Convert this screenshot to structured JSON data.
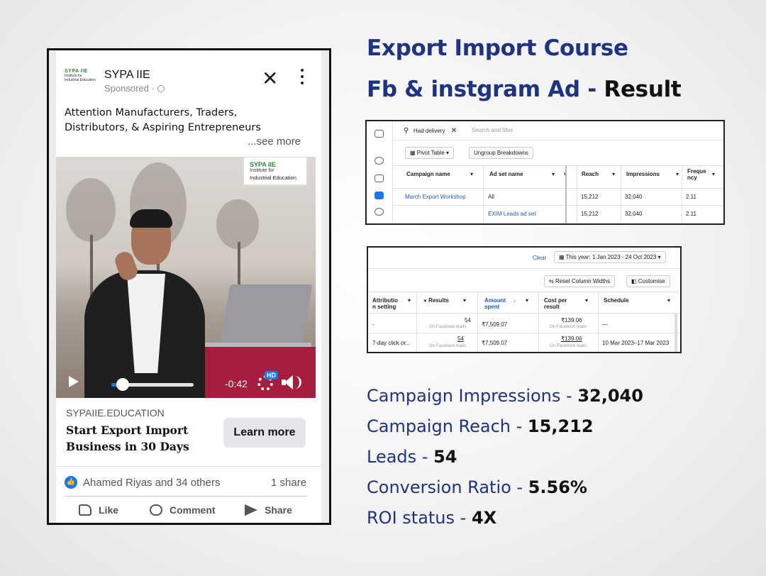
{
  "ad": {
    "logo_line1": "SYPA IIE",
    "logo_line2": "Institute for Industrial Education",
    "page_name": "SYPA IIE",
    "sponsored": "Sponsored ·",
    "body_text": "Attention Manufacturers, Traders, Distributors, & Aspiring Entrepreneurs",
    "see_more": "...see more",
    "video": {
      "watermark_line1": "SYPA IIE",
      "watermark_line2": "Institute for",
      "watermark_line3": "Industrial Education",
      "time_remaining": "-0:42",
      "hd_badge": "HD",
      "progress": 0.14
    },
    "domain": "SYPAIIE.EDUCATION",
    "headline": "Start Export Import Business in 30 Days",
    "cta": "Learn more",
    "reactions": "Ahamed Riyas and 34 others",
    "shares": "1 share",
    "actions": {
      "like": "Like",
      "comment": "Comment",
      "share": "Share"
    }
  },
  "title": {
    "line1": "Export Import Course",
    "line2_prefix": "Fb & instgram Ad -",
    "line2_result": "Result"
  },
  "ads_manager_1": {
    "filter_chip": "Had delivery",
    "search_placeholder": "Search and filter",
    "pivot_table": "Pivot Table",
    "ungroup": "Ungroup Breakdowns",
    "columns": [
      "Campaign name",
      "Ad set name",
      "Reach",
      "Impressions",
      "Freque ncy"
    ],
    "rows": [
      {
        "campaign": "March Export Workshop",
        "adset": "All",
        "reach": "15,212",
        "impressions": "32,040",
        "frequency": "2.11"
      },
      {
        "campaign": "",
        "adset": "EXIM Leads ad set",
        "reach": "15,212",
        "impressions": "32,040",
        "frequency": "2.11"
      }
    ]
  },
  "ads_manager_2": {
    "clear": "Clear",
    "date_range": "This year: 1 Jan 2023 - 24 Oct 2023",
    "reset_columns": "Reset Column Widths",
    "customise": "Customise",
    "columns": [
      "Attributio n setting",
      "Results",
      "Amount spent",
      "Cost per result",
      "Schedule"
    ],
    "rows": [
      {
        "attribution": "-",
        "results": "54",
        "results_sub": "On-Facebook leads",
        "amount": "₹7,509.07",
        "cost": "₹139.06",
        "cost_sub": "On-Facebook leads",
        "schedule": "—"
      },
      {
        "attribution": "7-day click or...",
        "results": "54",
        "results_sub": "On-Facebook leads",
        "amount": "₹7,509.07",
        "cost": "₹139.06",
        "cost_sub": "On-Facebook leads",
        "schedule": "10 Mar 2023–17 Mar 2023"
      }
    ]
  },
  "stats": [
    {
      "label": "Campaign Impressions - ",
      "value": "32,040"
    },
    {
      "label": "Campaign Reach - ",
      "value": "15,212"
    },
    {
      "label": "Leads - ",
      "value": "54"
    },
    {
      "label": "Conversion Ratio - ",
      "value": "5.56%"
    },
    {
      "label": "ROI status - ",
      "value": "4X"
    }
  ],
  "colors": {
    "brand_blue": "#1f3383",
    "facebook_blue": "#1877f2",
    "cta_grey": "#e4e6eb"
  }
}
